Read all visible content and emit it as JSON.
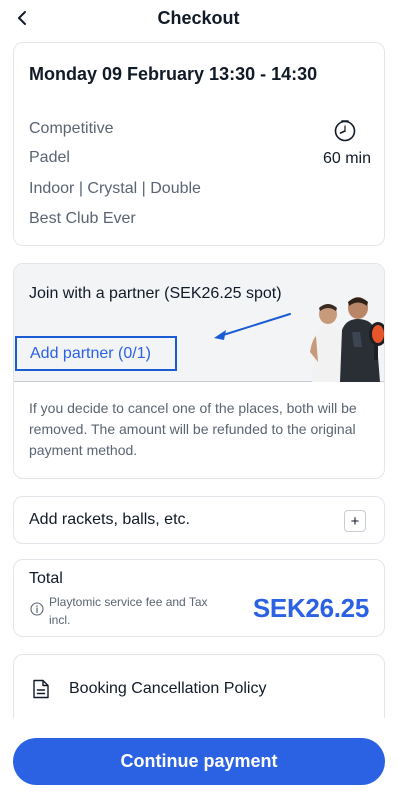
{
  "header": {
    "title": "Checkout",
    "back_icon": "chevron-left-icon"
  },
  "booking": {
    "title": "Monday 09 February 13:30 - 14:30",
    "level": "Competitive",
    "sport": "Padel",
    "court": "Indoor | Crystal | Double",
    "club": "Best Club Ever",
    "duration": "60 min",
    "clock_icon": "clock-icon"
  },
  "partner": {
    "title": "Join with a partner (SEK26.25 spot)",
    "add_label": "Add partner (0/1)",
    "note": "If you decide to cancel one of the places, both will be removed. The amount will be refunded to the original payment method.",
    "highlight_color": "#1b5cd6"
  },
  "extras": {
    "label": "Add rackets, balls, etc.",
    "plus": "+"
  },
  "total": {
    "label": "Total",
    "fee_note": "Playtomic service fee and Tax incl.",
    "amount": "SEK26.25"
  },
  "policy": {
    "label": "Booking Cancellation Policy",
    "icon": "document-icon"
  },
  "footer": {
    "continue_label": "Continue payment"
  },
  "colors": {
    "accent": "#2b61e3",
    "text": "#111a27",
    "muted": "#5a6472"
  }
}
